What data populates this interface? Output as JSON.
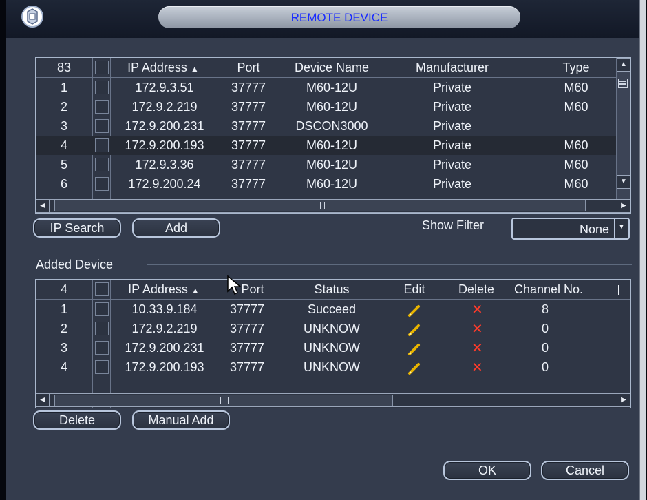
{
  "window": {
    "title": "REMOTE DEVICE"
  },
  "remote_table": {
    "headers": [
      "83",
      "IP Address",
      "Port",
      "Device Name",
      "Manufacturer",
      "Type"
    ],
    "rows": [
      {
        "num": "1",
        "ip": "172.9.3.51",
        "port": "37777",
        "name": "M60-12U",
        "manufacturer": "Private",
        "type": "M60"
      },
      {
        "num": "2",
        "ip": "172.9.2.219",
        "port": "37777",
        "name": "M60-12U",
        "manufacturer": "Private",
        "type": "M60"
      },
      {
        "num": "3",
        "ip": "172.9.200.231",
        "port": "37777",
        "name": "DSCON3000",
        "manufacturer": "Private",
        "type": ""
      },
      {
        "num": "4",
        "ip": "172.9.200.193",
        "port": "37777",
        "name": "M60-12U",
        "manufacturer": "Private",
        "type": "M60"
      },
      {
        "num": "5",
        "ip": "172.9.3.36",
        "port": "37777",
        "name": "M60-12U",
        "manufacturer": "Private",
        "type": "M60"
      },
      {
        "num": "6",
        "ip": "172.9.200.24",
        "port": "37777",
        "name": "M60-12U",
        "manufacturer": "Private",
        "type": "M60"
      }
    ],
    "selected_row": 3
  },
  "buttons": {
    "ip_search": "IP Search",
    "add": "Add",
    "delete": "Delete",
    "manual_add": "Manual Add",
    "ok": "OK",
    "cancel": "Cancel"
  },
  "filter": {
    "label": "Show Filter",
    "value": "None"
  },
  "added_section": {
    "title": "Added Device"
  },
  "added_table": {
    "headers": [
      "4",
      "IP Address",
      "Port",
      "Status",
      "Edit",
      "Delete",
      "Channel No."
    ],
    "rows": [
      {
        "num": "1",
        "ip": "10.33.9.184",
        "port": "37777",
        "status": "Succeed",
        "channel": "8"
      },
      {
        "num": "2",
        "ip": "172.9.2.219",
        "port": "37777",
        "status": "UNKNOW",
        "channel": "0"
      },
      {
        "num": "3",
        "ip": "172.9.200.231",
        "port": "37777",
        "status": "UNKNOW",
        "channel": "0"
      },
      {
        "num": "4",
        "ip": "172.9.200.193",
        "port": "37777",
        "status": "UNKNOW",
        "channel": "0"
      }
    ]
  },
  "colors": {
    "background": "#343c4d",
    "title_text": "#1a2cff",
    "delete_icon": "#ff3b2a",
    "edit_icon": "#e8b400"
  }
}
